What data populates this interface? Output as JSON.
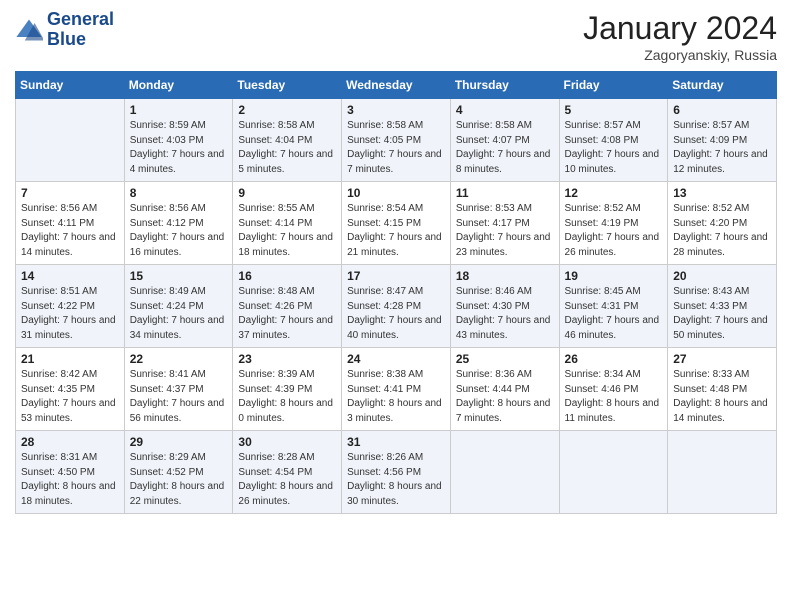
{
  "header": {
    "logo_line1": "General",
    "logo_line2": "Blue",
    "month_title": "January 2024",
    "location": "Zagoryanskiy, Russia"
  },
  "days_of_week": [
    "Sunday",
    "Monday",
    "Tuesday",
    "Wednesday",
    "Thursday",
    "Friday",
    "Saturday"
  ],
  "weeks": [
    [
      {
        "day": "",
        "sunrise": "",
        "sunset": "",
        "daylight": ""
      },
      {
        "day": "1",
        "sunrise": "Sunrise: 8:59 AM",
        "sunset": "Sunset: 4:03 PM",
        "daylight": "Daylight: 7 hours and 4 minutes."
      },
      {
        "day": "2",
        "sunrise": "Sunrise: 8:58 AM",
        "sunset": "Sunset: 4:04 PM",
        "daylight": "Daylight: 7 hours and 5 minutes."
      },
      {
        "day": "3",
        "sunrise": "Sunrise: 8:58 AM",
        "sunset": "Sunset: 4:05 PM",
        "daylight": "Daylight: 7 hours and 7 minutes."
      },
      {
        "day": "4",
        "sunrise": "Sunrise: 8:58 AM",
        "sunset": "Sunset: 4:07 PM",
        "daylight": "Daylight: 7 hours and 8 minutes."
      },
      {
        "day": "5",
        "sunrise": "Sunrise: 8:57 AM",
        "sunset": "Sunset: 4:08 PM",
        "daylight": "Daylight: 7 hours and 10 minutes."
      },
      {
        "day": "6",
        "sunrise": "Sunrise: 8:57 AM",
        "sunset": "Sunset: 4:09 PM",
        "daylight": "Daylight: 7 hours and 12 minutes."
      }
    ],
    [
      {
        "day": "7",
        "sunrise": "Sunrise: 8:56 AM",
        "sunset": "Sunset: 4:11 PM",
        "daylight": "Daylight: 7 hours and 14 minutes."
      },
      {
        "day": "8",
        "sunrise": "Sunrise: 8:56 AM",
        "sunset": "Sunset: 4:12 PM",
        "daylight": "Daylight: 7 hours and 16 minutes."
      },
      {
        "day": "9",
        "sunrise": "Sunrise: 8:55 AM",
        "sunset": "Sunset: 4:14 PM",
        "daylight": "Daylight: 7 hours and 18 minutes."
      },
      {
        "day": "10",
        "sunrise": "Sunrise: 8:54 AM",
        "sunset": "Sunset: 4:15 PM",
        "daylight": "Daylight: 7 hours and 21 minutes."
      },
      {
        "day": "11",
        "sunrise": "Sunrise: 8:53 AM",
        "sunset": "Sunset: 4:17 PM",
        "daylight": "Daylight: 7 hours and 23 minutes."
      },
      {
        "day": "12",
        "sunrise": "Sunrise: 8:52 AM",
        "sunset": "Sunset: 4:19 PM",
        "daylight": "Daylight: 7 hours and 26 minutes."
      },
      {
        "day": "13",
        "sunrise": "Sunrise: 8:52 AM",
        "sunset": "Sunset: 4:20 PM",
        "daylight": "Daylight: 7 hours and 28 minutes."
      }
    ],
    [
      {
        "day": "14",
        "sunrise": "Sunrise: 8:51 AM",
        "sunset": "Sunset: 4:22 PM",
        "daylight": "Daylight: 7 hours and 31 minutes."
      },
      {
        "day": "15",
        "sunrise": "Sunrise: 8:49 AM",
        "sunset": "Sunset: 4:24 PM",
        "daylight": "Daylight: 7 hours and 34 minutes."
      },
      {
        "day": "16",
        "sunrise": "Sunrise: 8:48 AM",
        "sunset": "Sunset: 4:26 PM",
        "daylight": "Daylight: 7 hours and 37 minutes."
      },
      {
        "day": "17",
        "sunrise": "Sunrise: 8:47 AM",
        "sunset": "Sunset: 4:28 PM",
        "daylight": "Daylight: 7 hours and 40 minutes."
      },
      {
        "day": "18",
        "sunrise": "Sunrise: 8:46 AM",
        "sunset": "Sunset: 4:30 PM",
        "daylight": "Daylight: 7 hours and 43 minutes."
      },
      {
        "day": "19",
        "sunrise": "Sunrise: 8:45 AM",
        "sunset": "Sunset: 4:31 PM",
        "daylight": "Daylight: 7 hours and 46 minutes."
      },
      {
        "day": "20",
        "sunrise": "Sunrise: 8:43 AM",
        "sunset": "Sunset: 4:33 PM",
        "daylight": "Daylight: 7 hours and 50 minutes."
      }
    ],
    [
      {
        "day": "21",
        "sunrise": "Sunrise: 8:42 AM",
        "sunset": "Sunset: 4:35 PM",
        "daylight": "Daylight: 7 hours and 53 minutes."
      },
      {
        "day": "22",
        "sunrise": "Sunrise: 8:41 AM",
        "sunset": "Sunset: 4:37 PM",
        "daylight": "Daylight: 7 hours and 56 minutes."
      },
      {
        "day": "23",
        "sunrise": "Sunrise: 8:39 AM",
        "sunset": "Sunset: 4:39 PM",
        "daylight": "Daylight: 8 hours and 0 minutes."
      },
      {
        "day": "24",
        "sunrise": "Sunrise: 8:38 AM",
        "sunset": "Sunset: 4:41 PM",
        "daylight": "Daylight: 8 hours and 3 minutes."
      },
      {
        "day": "25",
        "sunrise": "Sunrise: 8:36 AM",
        "sunset": "Sunset: 4:44 PM",
        "daylight": "Daylight: 8 hours and 7 minutes."
      },
      {
        "day": "26",
        "sunrise": "Sunrise: 8:34 AM",
        "sunset": "Sunset: 4:46 PM",
        "daylight": "Daylight: 8 hours and 11 minutes."
      },
      {
        "day": "27",
        "sunrise": "Sunrise: 8:33 AM",
        "sunset": "Sunset: 4:48 PM",
        "daylight": "Daylight: 8 hours and 14 minutes."
      }
    ],
    [
      {
        "day": "28",
        "sunrise": "Sunrise: 8:31 AM",
        "sunset": "Sunset: 4:50 PM",
        "daylight": "Daylight: 8 hours and 18 minutes."
      },
      {
        "day": "29",
        "sunrise": "Sunrise: 8:29 AM",
        "sunset": "Sunset: 4:52 PM",
        "daylight": "Daylight: 8 hours and 22 minutes."
      },
      {
        "day": "30",
        "sunrise": "Sunrise: 8:28 AM",
        "sunset": "Sunset: 4:54 PM",
        "daylight": "Daylight: 8 hours and 26 minutes."
      },
      {
        "day": "31",
        "sunrise": "Sunrise: 8:26 AM",
        "sunset": "Sunset: 4:56 PM",
        "daylight": "Daylight: 8 hours and 30 minutes."
      },
      {
        "day": "",
        "sunrise": "",
        "sunset": "",
        "daylight": ""
      },
      {
        "day": "",
        "sunrise": "",
        "sunset": "",
        "daylight": ""
      },
      {
        "day": "",
        "sunrise": "",
        "sunset": "",
        "daylight": ""
      }
    ]
  ]
}
